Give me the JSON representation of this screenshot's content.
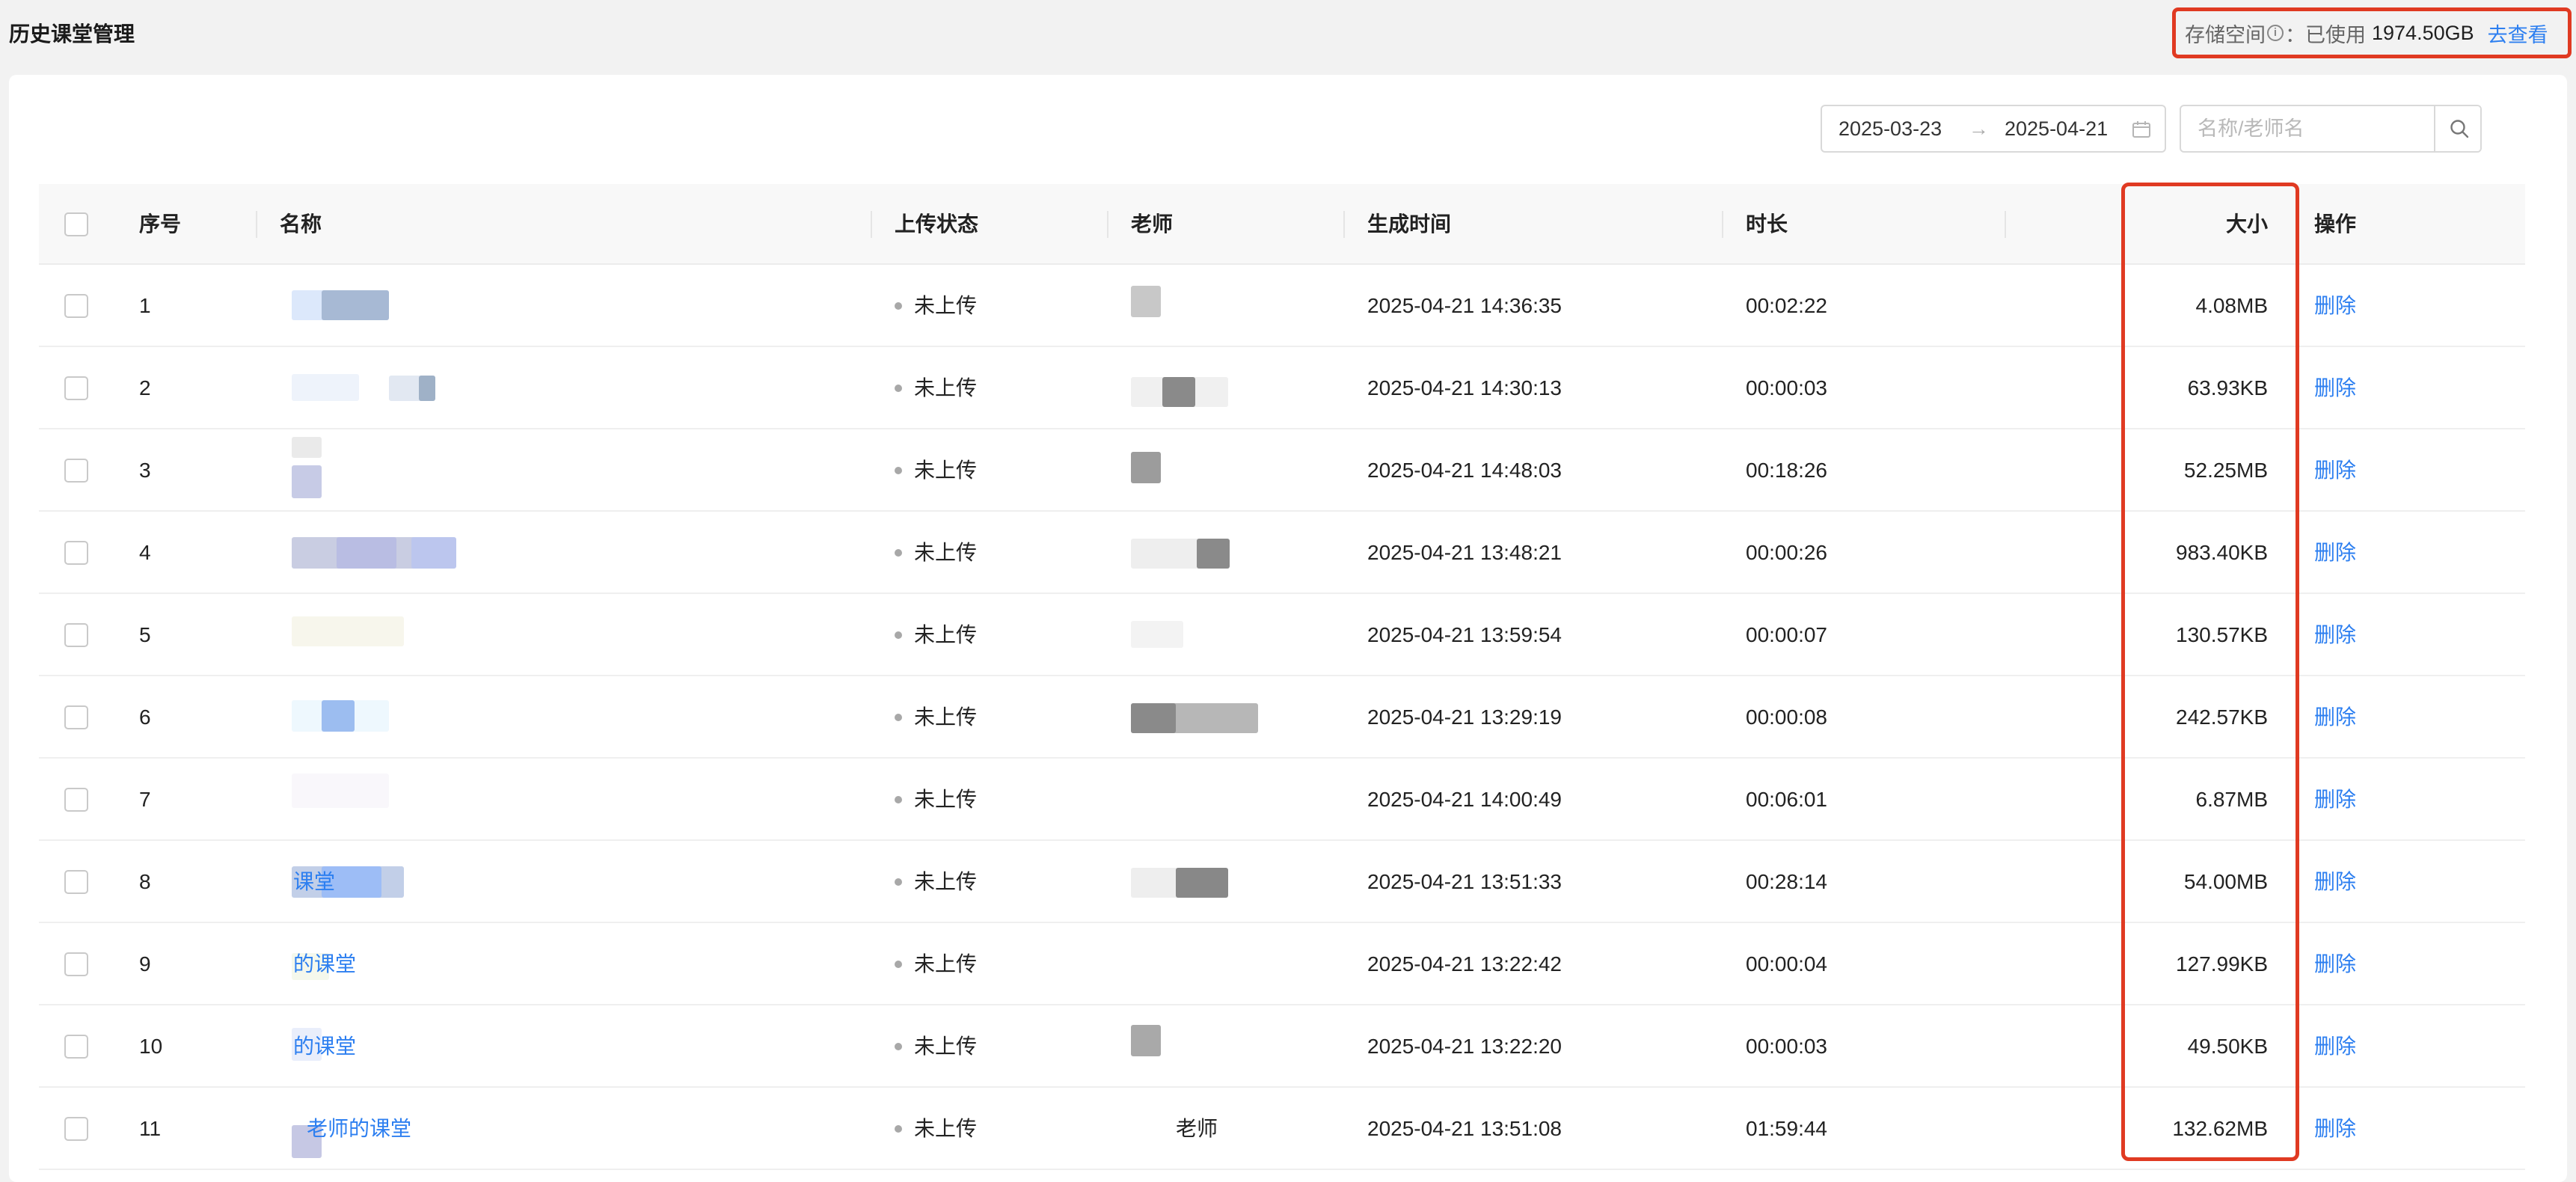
{
  "header": {
    "title": "历史课堂管理",
    "storage": {
      "label": "存储空间",
      "info_icon": "info-icon",
      "separator": "：已使用",
      "used": "1974.50GB",
      "link": "去查看"
    }
  },
  "filters": {
    "date_start": "2025-03-23",
    "date_arrow": "→",
    "date_end": "2025-04-21",
    "calendar_icon": "calendar-icon",
    "search_placeholder": "名称/老师名",
    "search_icon": "search-icon"
  },
  "table": {
    "columns": {
      "index": "序号",
      "name": "名称",
      "upload_status": "上传状态",
      "teacher": "老师",
      "created": "生成时间",
      "duration": "时长",
      "size": "大小",
      "actions": "操作"
    },
    "rows": [
      {
        "index": "1",
        "name": "",
        "status": "未上传",
        "teacher": "",
        "created": "2025-04-21 14:36:35",
        "duration": "00:02:22",
        "size": "4.08MB",
        "action": "删除"
      },
      {
        "index": "2",
        "name": "",
        "status": "未上传",
        "teacher": "",
        "created": "2025-04-21 14:30:13",
        "duration": "00:00:03",
        "size": "63.93KB",
        "action": "删除"
      },
      {
        "index": "3",
        "name": "",
        "status": "未上传",
        "teacher": "",
        "created": "2025-04-21 14:48:03",
        "duration": "00:18:26",
        "size": "52.25MB",
        "action": "删除"
      },
      {
        "index": "4",
        "name": "",
        "status": "未上传",
        "teacher": "",
        "created": "2025-04-21 13:48:21",
        "duration": "00:00:26",
        "size": "983.40KB",
        "action": "删除"
      },
      {
        "index": "5",
        "name": "",
        "status": "未上传",
        "teacher": "",
        "created": "2025-04-21 13:59:54",
        "duration": "00:00:07",
        "size": "130.57KB",
        "action": "删除"
      },
      {
        "index": "6",
        "name": "",
        "status": "未上传",
        "teacher": "",
        "created": "2025-04-21 13:29:19",
        "duration": "00:00:08",
        "size": "242.57KB",
        "action": "删除"
      },
      {
        "index": "7",
        "name": "",
        "status": "未上传",
        "teacher": "",
        "created": "2025-04-21 14:00:49",
        "duration": "00:06:01",
        "size": "6.87MB",
        "action": "删除"
      },
      {
        "index": "8",
        "name": "课堂",
        "status": "未上传",
        "teacher": "",
        "created": "2025-04-21 13:51:33",
        "duration": "00:28:14",
        "size": "54.00MB",
        "action": "删除"
      },
      {
        "index": "9",
        "name": "的课堂",
        "status": "未上传",
        "teacher": "",
        "created": "2025-04-21 13:22:42",
        "duration": "00:00:04",
        "size": "127.99KB",
        "action": "删除"
      },
      {
        "index": "10",
        "name": "的课堂",
        "status": "未上传",
        "teacher": "",
        "created": "2025-04-21 13:22:20",
        "duration": "00:00:03",
        "size": "49.50KB",
        "action": "删除"
      },
      {
        "index": "11",
        "name": "老师的课堂",
        "status": "未上传",
        "teacher": "老师",
        "created": "2025-04-21 13:51:08",
        "duration": "01:59:44",
        "size": "132.62MB",
        "action": "删除"
      }
    ]
  },
  "colors": {
    "accent": "#2d7ff0",
    "highlight": "#e03a22",
    "status_dot": "#a8a8a8"
  }
}
